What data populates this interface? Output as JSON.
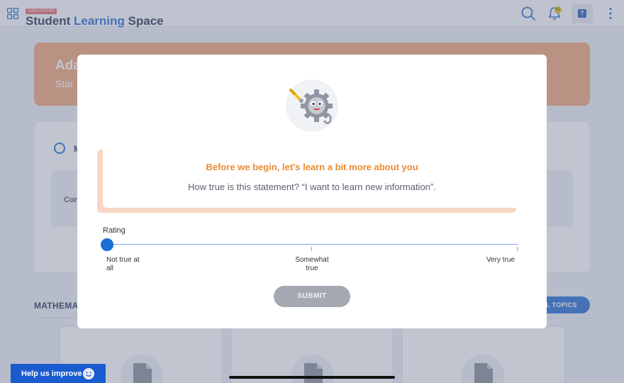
{
  "app": {
    "logo_badge": "SINGAPORE",
    "logo_word1": "Student",
    "logo_word2": "Learning",
    "logo_word3": "Space",
    "notifications_count": "61"
  },
  "background": {
    "hero_title": "Ada",
    "hero_subtitle": "Star",
    "panel_label": "M",
    "card_text": "Con",
    "section_title": "MATHEMA",
    "all_topics_label": "LL TOPICS"
  },
  "modal": {
    "heading": "Before we begin, let's learn a bit more about you",
    "question": "How true is this statement? “I want to learn new information”.",
    "rating_label": "Rating",
    "rating_value": 0,
    "options": [
      {
        "label_line1": "Not true at",
        "label_line2": "all"
      },
      {
        "label_line1": "Somewhat",
        "label_line2": "true"
      },
      {
        "label_line1": "Very true",
        "label_line2": ""
      }
    ],
    "submit_label": "SUBMIT"
  },
  "footer": {
    "help_label": "Help us improve"
  },
  "colors": {
    "accent_blue": "#1a6ed6",
    "heading_orange": "#ee8a2e",
    "hero_orange": "#f2a87c",
    "submit_disabled": "#a4a8b0"
  }
}
